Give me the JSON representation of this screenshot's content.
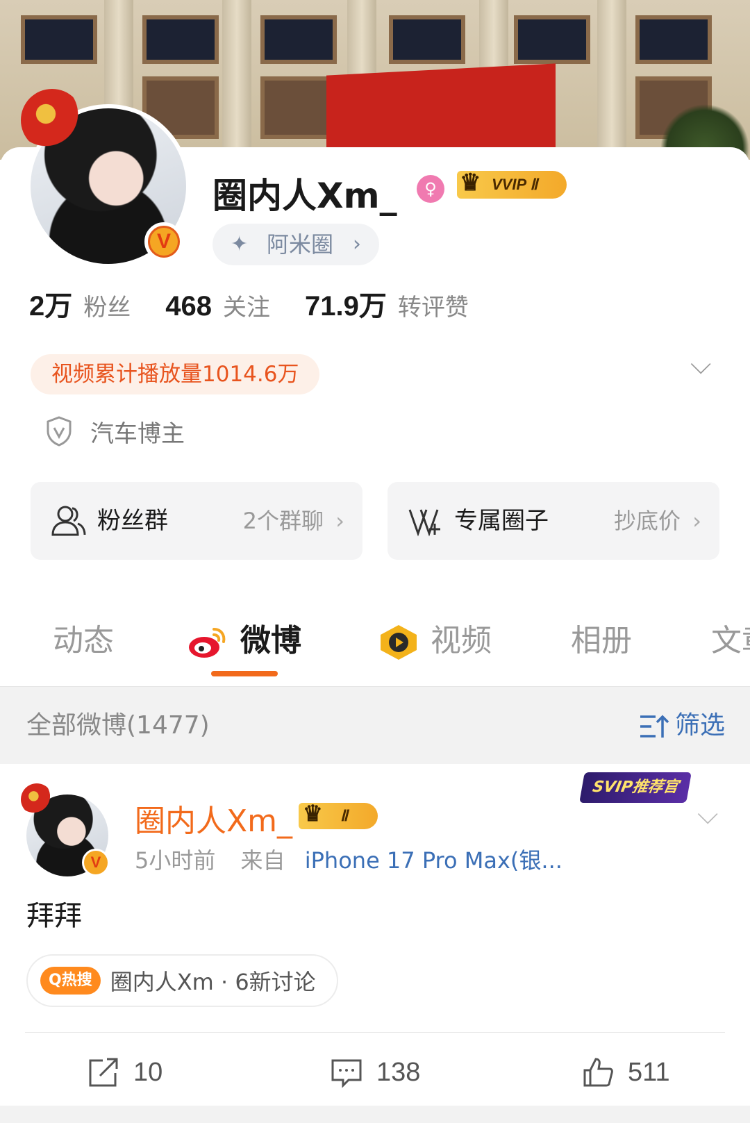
{
  "profile": {
    "username": "圈内人Xm_",
    "gender_icon": "female-icon",
    "vip_badge": "VVIP Ⅱ",
    "circle_pill": "阿米圈",
    "verified_badge": "V"
  },
  "stats": [
    {
      "num": "2万",
      "label": "粉丝"
    },
    {
      "num": "468",
      "label": "关注"
    },
    {
      "num": "71.9万",
      "label": "转评赞"
    }
  ],
  "video_plays": "视频累计播放量1014.6万",
  "tag": "汽车博主",
  "boxes": {
    "left": {
      "title": "粉丝群",
      "sub": "2个群聊"
    },
    "right": {
      "title": "专属圈子",
      "sub": "抄底价"
    }
  },
  "tabs": [
    "动态",
    "微博",
    "视频",
    "相册",
    "文章"
  ],
  "active_tab": "微博",
  "filter": {
    "count_label": "全部微博(1477)",
    "filter_label": "筛选"
  },
  "post": {
    "author": "圈内人Xm_",
    "vip_level": "Ⅱ",
    "svip_badge": "SVIP推荐官",
    "time": "5小时前",
    "from_label": "来自",
    "source": "iPhone 17 Pro Max(银...",
    "text": "拜拜",
    "hot_tag": "Q热搜",
    "hot_text": "圈内人Xm · 6新讨论",
    "reposts": "10",
    "comments": "138",
    "likes": "511"
  },
  "colors": {
    "accent_orange": "#f26a1b",
    "link_blue": "#3b6fb6",
    "gold": "#f3a92a"
  }
}
